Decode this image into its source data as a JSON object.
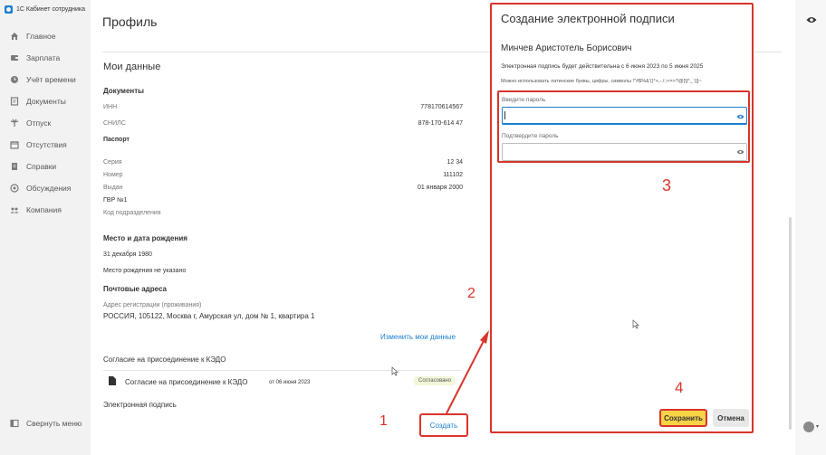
{
  "app": {
    "title": "1С Кабинет сотрудника"
  },
  "sidebar": {
    "items": [
      {
        "label": "Главное",
        "icon": "home-icon"
      },
      {
        "label": "Зарплата",
        "icon": "wallet-icon"
      },
      {
        "label": "Учёт времени",
        "icon": "clock-icon"
      },
      {
        "label": "Документы",
        "icon": "documents-icon"
      },
      {
        "label": "Отпуск",
        "icon": "palm-icon"
      },
      {
        "label": "Отсутствия",
        "icon": "calendar-icon"
      },
      {
        "label": "Справки",
        "icon": "certificate-icon"
      },
      {
        "label": "Обсуждения",
        "icon": "discussion-icon"
      },
      {
        "label": "Компания",
        "icon": "company-icon"
      }
    ],
    "collapse_label": "Свернуть меню"
  },
  "page": {
    "title": "Профиль",
    "section_title": "Мои данные",
    "documents": {
      "heading": "Документы",
      "inn_label": "ИНН",
      "inn_value": "778170614567",
      "snils_label": "СНИЛС",
      "snils_value": "878-170-614 47"
    },
    "passport": {
      "heading": "Паспорт",
      "series_label": "Серия",
      "series_value": "12 34",
      "number_label": "Номер",
      "number_value": "111102",
      "issued_label": "Выдан",
      "issued_value": "01 января 2000",
      "issuer": "ГВР №1",
      "division_label": "Код подразделения"
    },
    "birth": {
      "heading": "Место и дата рождения",
      "date": "31 декабря 1980",
      "place": "Место рождения не указано"
    },
    "addresses": {
      "heading": "Почтовые адреса",
      "reg_label": "Адрес регистрации (проживания)",
      "reg_value": "РОССИЯ, 105122, Москва г, Амурская ул, дом № 1, квартира 1"
    },
    "edit_link": "Изменить мои данные",
    "kedo": {
      "heading": "Согласие на присоединение к КЭДО",
      "doc_name": "Согласие на присоединение к КЭДО",
      "doc_date": "от 06 июня 2023",
      "status": "Согласовано"
    },
    "esign": {
      "heading": "Электронная подпись",
      "create_label": "Создать"
    }
  },
  "modal": {
    "title": "Создание электронной подписи",
    "name": "Минчев Аристотель Борисович",
    "validity": "Электронная подпись будет действительна с 6 июня 2023 по 5 июня 2025",
    "hint": "Можно использовать латинские буквы, цифры, символы !\"#$%&'()*+,-./:;<=>?@[\\]^_`{|}~",
    "password_label": "Введите пароль",
    "password_value": "",
    "confirm_label": "Подтвердите пароль",
    "confirm_value": "",
    "save_label": "Сохранить",
    "cancel_label": "Отмена"
  },
  "annotations": {
    "n1": "1",
    "n2": "2",
    "n3": "3",
    "n4": "4"
  },
  "colors": {
    "accent": "#1b7fd1",
    "annotation": "#d9342b",
    "save": "#f7d348"
  }
}
